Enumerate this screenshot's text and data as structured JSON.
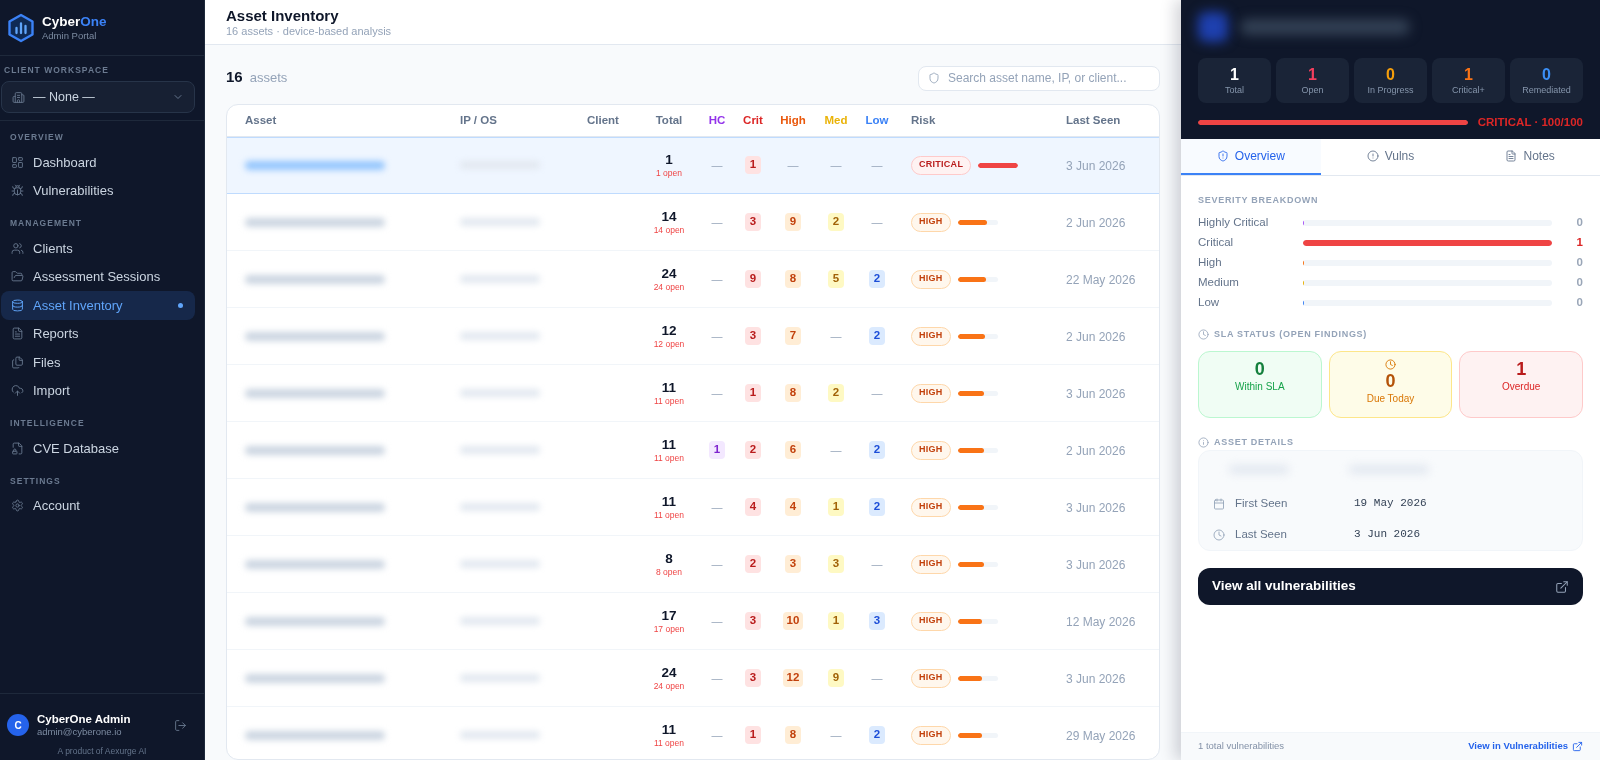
{
  "sidebar": {
    "brand": {
      "name": "Cyber",
      "accent": "One",
      "subtitle": "Admin Portal"
    },
    "workspace": {
      "label": "CLIENT WORKSPACE",
      "value": "— None —"
    },
    "sections": [
      {
        "title": "OVERVIEW",
        "items": [
          {
            "label": "Dashboard",
            "selected": false
          },
          {
            "label": "Vulnerabilities",
            "selected": false
          }
        ]
      },
      {
        "title": "MANAGEMENT",
        "items": [
          {
            "label": "Clients",
            "selected": false
          },
          {
            "label": "Assessment Sessions",
            "selected": false
          },
          {
            "label": "Asset Inventory",
            "selected": true
          },
          {
            "label": "Reports",
            "selected": false
          },
          {
            "label": "Files",
            "selected": false
          },
          {
            "label": "Import",
            "selected": false
          }
        ]
      },
      {
        "title": "INTELLIGENCE",
        "items": [
          {
            "label": "CVE Database",
            "selected": false
          }
        ]
      },
      {
        "title": "SETTINGS",
        "items": [
          {
            "label": "Account",
            "selected": false
          }
        ]
      }
    ],
    "user": {
      "initial": "C",
      "name": "CyberOne Admin",
      "email": "admin@cyberone.io"
    },
    "credit": "A product of Aexurge AI"
  },
  "header": {
    "title": "Asset Inventory",
    "subtitle": "16 assets · device-based analysis"
  },
  "toolbar": {
    "count": "16",
    "count_label": "assets",
    "search": {
      "placeholder": "Search asset name, IP, or client..."
    }
  },
  "table": {
    "columns": [
      {
        "label": "Asset",
        "kind": "asset"
      },
      {
        "label": "IP / OS",
        "kind": "ip"
      },
      {
        "label": "Client",
        "kind": "client"
      },
      {
        "label": "Total",
        "kind": "total"
      },
      {
        "label": "HC",
        "kind": "hc"
      },
      {
        "label": "Crit",
        "kind": "crit"
      },
      {
        "label": "High",
        "kind": "high"
      },
      {
        "label": "Med",
        "kind": "med"
      },
      {
        "label": "Low",
        "kind": "low"
      },
      {
        "label": "Risk",
        "kind": "risk"
      },
      {
        "label": "Last Seen",
        "kind": "last_seen"
      }
    ],
    "rows": [
      {
        "selected": true,
        "total": "1",
        "open": "1 open",
        "counts": [
          {
            "kind": "none",
            "text": "—"
          },
          {
            "kind": "count",
            "text": "1"
          },
          {
            "kind": "none",
            "text": "—"
          },
          {
            "kind": "none",
            "text": "—"
          },
          {
            "kind": "none",
            "text": "—"
          }
        ],
        "risk": {
          "kind": "critical",
          "label": "CRITICAL",
          "level": 1
        },
        "last_seen": "3 Jun 2026"
      },
      {
        "selected": false,
        "total": "14",
        "open": "14 open",
        "counts": [
          {
            "kind": "none",
            "text": "—"
          },
          {
            "kind": "count",
            "text": "3"
          },
          {
            "kind": "count",
            "text": "9"
          },
          {
            "kind": "count",
            "text": "2"
          },
          {
            "kind": "none",
            "text": "—"
          }
        ],
        "risk": {
          "kind": "high",
          "label": "HIGH",
          "level": 0.73
        },
        "last_seen": "2 Jun 2026"
      },
      {
        "selected": false,
        "total": "24",
        "open": "24 open",
        "counts": [
          {
            "kind": "none",
            "text": "—"
          },
          {
            "kind": "count",
            "text": "9"
          },
          {
            "kind": "count",
            "text": "8"
          },
          {
            "kind": "count",
            "text": "5"
          },
          {
            "kind": "count",
            "text": "2"
          }
        ],
        "risk": {
          "kind": "high",
          "label": "HIGH",
          "level": 0.7
        },
        "last_seen": "22 May 2026"
      },
      {
        "selected": false,
        "total": "12",
        "open": "12 open",
        "counts": [
          {
            "kind": "none",
            "text": "—"
          },
          {
            "kind": "count",
            "text": "3"
          },
          {
            "kind": "count",
            "text": "7"
          },
          {
            "kind": "none",
            "text": "—"
          },
          {
            "kind": "count",
            "text": "2"
          }
        ],
        "risk": {
          "kind": "high",
          "label": "HIGH",
          "level": 0.68
        },
        "last_seen": "2 Jun 2026"
      },
      {
        "selected": false,
        "total": "11",
        "open": "11 open",
        "counts": [
          {
            "kind": "none",
            "text": "—"
          },
          {
            "kind": "count",
            "text": "1"
          },
          {
            "kind": "count",
            "text": "8"
          },
          {
            "kind": "count",
            "text": "2"
          },
          {
            "kind": "none",
            "text": "—"
          }
        ],
        "risk": {
          "kind": "high",
          "label": "HIGH",
          "level": 0.66
        },
        "last_seen": "3 Jun 2026"
      },
      {
        "selected": false,
        "total": "11",
        "open": "11 open",
        "counts": [
          {
            "kind": "count",
            "text": "1"
          },
          {
            "kind": "count",
            "text": "2"
          },
          {
            "kind": "count",
            "text": "6"
          },
          {
            "kind": "none",
            "text": "—"
          },
          {
            "kind": "count",
            "text": "2"
          }
        ],
        "risk": {
          "kind": "high",
          "label": "HIGH",
          "level": 0.66
        },
        "last_seen": "2 Jun 2026"
      },
      {
        "selected": false,
        "total": "11",
        "open": "11 open",
        "counts": [
          {
            "kind": "none",
            "text": "—"
          },
          {
            "kind": "count",
            "text": "4"
          },
          {
            "kind": "count",
            "text": "4"
          },
          {
            "kind": "count",
            "text": "1"
          },
          {
            "kind": "count",
            "text": "2"
          }
        ],
        "risk": {
          "kind": "high",
          "label": "HIGH",
          "level": 0.66
        },
        "last_seen": "3 Jun 2026"
      },
      {
        "selected": false,
        "total": "8",
        "open": "8 open",
        "counts": [
          {
            "kind": "none",
            "text": "—"
          },
          {
            "kind": "count",
            "text": "2"
          },
          {
            "kind": "count",
            "text": "3"
          },
          {
            "kind": "count",
            "text": "3"
          },
          {
            "kind": "none",
            "text": "—"
          }
        ],
        "risk": {
          "kind": "high",
          "label": "HIGH",
          "level": 0.66
        },
        "last_seen": "3 Jun 2026"
      },
      {
        "selected": false,
        "total": "17",
        "open": "17 open",
        "counts": [
          {
            "kind": "none",
            "text": "—"
          },
          {
            "kind": "count",
            "text": "3"
          },
          {
            "kind": "count",
            "text": "10"
          },
          {
            "kind": "count",
            "text": "1"
          },
          {
            "kind": "count",
            "text": "3"
          }
        ],
        "risk": {
          "kind": "high",
          "label": "HIGH",
          "level": 0.62
        },
        "last_seen": "12 May 2026"
      },
      {
        "selected": false,
        "total": "24",
        "open": "24 open",
        "counts": [
          {
            "kind": "none",
            "text": "—"
          },
          {
            "kind": "count",
            "text": "3"
          },
          {
            "kind": "count",
            "text": "12"
          },
          {
            "kind": "count",
            "text": "9"
          },
          {
            "kind": "none",
            "text": "—"
          }
        ],
        "risk": {
          "kind": "high",
          "label": "HIGH",
          "level": 0.62
        },
        "last_seen": "3 Jun 2026"
      },
      {
        "selected": false,
        "total": "11",
        "open": "11 open",
        "counts": [
          {
            "kind": "none",
            "text": "—"
          },
          {
            "kind": "count",
            "text": "1"
          },
          {
            "kind": "count",
            "text": "8"
          },
          {
            "kind": "none",
            "text": "—"
          },
          {
            "kind": "count",
            "text": "2"
          }
        ],
        "risk": {
          "kind": "high",
          "label": "HIGH",
          "level": 0.62
        },
        "last_seen": "29 May 2026"
      }
    ]
  },
  "detail_panel": {
    "stats": [
      {
        "kind": "total",
        "value": "1",
        "label": "Total"
      },
      {
        "kind": "open",
        "value": "1",
        "label": "Open"
      },
      {
        "kind": "in_progress",
        "value": "0",
        "label": "In Progress"
      },
      {
        "kind": "critical_plus",
        "value": "1",
        "label": "Critical+"
      },
      {
        "kind": "remediated",
        "value": "0",
        "label": "Remediated"
      }
    ],
    "risk": {
      "kind": "critical",
      "level": 1,
      "label": "CRITICAL · 100/100"
    },
    "tabs": [
      {
        "label": "Overview",
        "selected": true
      },
      {
        "label": "Vulns",
        "selected": false
      },
      {
        "label": "Notes",
        "selected": false
      }
    ],
    "severity_breakdown": {
      "title": "SEVERITY BREAKDOWN",
      "rows": [
        {
          "kind": "hc",
          "label": "Highly Critical",
          "count": "0",
          "level": 0
        },
        {
          "kind": "crit",
          "label": "Critical",
          "count": "1",
          "level": 1
        },
        {
          "kind": "high",
          "label": "High",
          "count": "0",
          "level": 0
        },
        {
          "kind": "med",
          "label": "Medium",
          "count": "0",
          "level": 0
        },
        {
          "kind": "low",
          "label": "Low",
          "count": "0",
          "level": 0
        }
      ]
    },
    "sla": {
      "title": "SLA STATUS (OPEN FINDINGS)",
      "cards": [
        {
          "kind": "within",
          "value": "0",
          "label": "Within SLA"
        },
        {
          "kind": "due_today",
          "value": "0",
          "label": "Due Today"
        },
        {
          "kind": "overdue",
          "value": "1",
          "label": "Overdue"
        }
      ]
    },
    "asset_details": {
      "title": "ASSET DETAILS",
      "rows": [
        {
          "kind": "first_seen",
          "label": "First Seen",
          "value": "19 May 2026"
        },
        {
          "kind": "last_seen",
          "label": "Last Seen",
          "value": "3 Jun 2026"
        }
      ]
    },
    "action": {
      "label": "View all vulnerabilities"
    },
    "footer": {
      "summary": "1 total vulnerabilities",
      "link": "View in Vulnerabilities"
    }
  }
}
